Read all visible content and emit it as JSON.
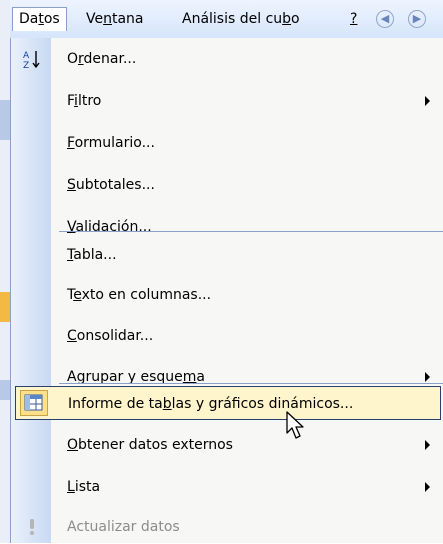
{
  "menubar": {
    "items": [
      {
        "pre": "Da",
        "u": "t",
        "post": "os"
      },
      {
        "pre": "Ve",
        "u": "n",
        "post": "tana"
      },
      {
        "pre": "Análisis del cu",
        "u": "b",
        "post": "o"
      },
      {
        "pre": "",
        "u": "?",
        "post": ""
      }
    ]
  },
  "menu": {
    "items": [
      {
        "pre": "O",
        "u": "r",
        "post": "denar..."
      },
      {
        "pre": "F",
        "u": "i",
        "post": "ltro"
      },
      {
        "pre": "",
        "u": "F",
        "post": "ormulario..."
      },
      {
        "pre": "",
        "u": "S",
        "post": "ubtotales..."
      },
      {
        "pre": "",
        "u": "V",
        "post": "alidación..."
      },
      {
        "pre": "",
        "u": "T",
        "post": "abla..."
      },
      {
        "pre": "T",
        "u": "e",
        "post": "xto en columnas..."
      },
      {
        "pre": "",
        "u": "C",
        "post": "onsolidar..."
      },
      {
        "pre": "Agrupar y esque",
        "u": "m",
        "post": "a"
      },
      {
        "pre": "Informe de ta",
        "u": "b",
        "post": "las y gráficos dinámicos..."
      },
      {
        "pre": "",
        "u": "O",
        "post": "btener datos externos"
      },
      {
        "pre": "",
        "u": "L",
        "post": "ista"
      },
      {
        "pre": "Actualizar datos",
        "u": "",
        "post": ""
      }
    ]
  },
  "icons": {
    "sort": "sort-az-icon",
    "pivot": "pivot-table-icon",
    "refresh": "refresh-exclamation-icon",
    "back": "back-circle-icon",
    "forward": "forward-circle-icon",
    "cursor": "mouse-pointer-icon"
  },
  "colors": {
    "menubar_bg": "#d6e5fb",
    "gutter": "#c8d9f2",
    "hover_bg": "#fff5cc",
    "hover_border": "#2a3f6c",
    "separator": "#8aa0c8",
    "disabled_text": "#8c8c8c"
  }
}
